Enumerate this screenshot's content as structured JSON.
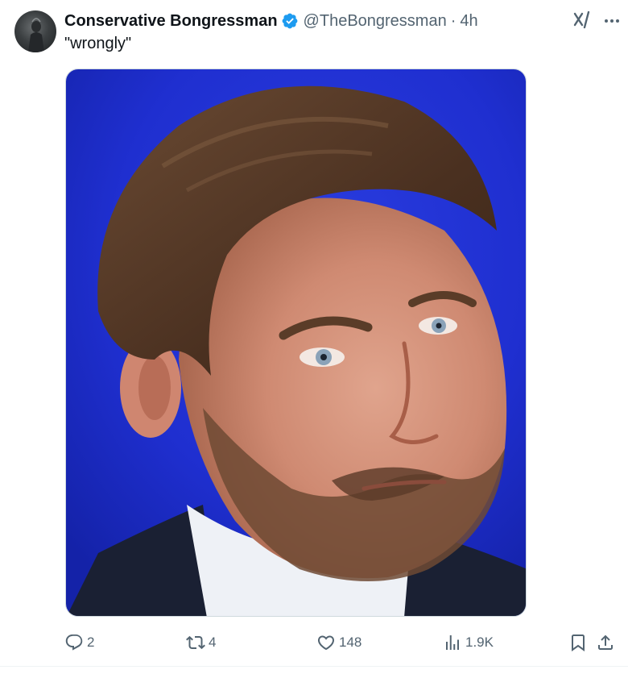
{
  "author": {
    "display_name": "Conservative Bongressman",
    "handle": "@TheBongressman",
    "separator": "·",
    "time": "4h",
    "verified": true
  },
  "tweet": {
    "text": "\"wrongly\""
  },
  "media": {
    "kind": "photo"
  },
  "actions": {
    "replies": "2",
    "reposts": "4",
    "likes": "148",
    "views": "1.9K"
  },
  "colors": {
    "text_primary": "#0f1419",
    "text_secondary": "#536471",
    "verified_blue": "#1d9bf0",
    "media_background": "#1f2fd0"
  },
  "icons": {
    "header": [
      "grok-icon",
      "more-icon",
      "verified-badge-icon"
    ],
    "actions": [
      "reply-icon",
      "repost-icon",
      "like-icon",
      "views-icon",
      "bookmark-icon",
      "share-icon"
    ]
  }
}
